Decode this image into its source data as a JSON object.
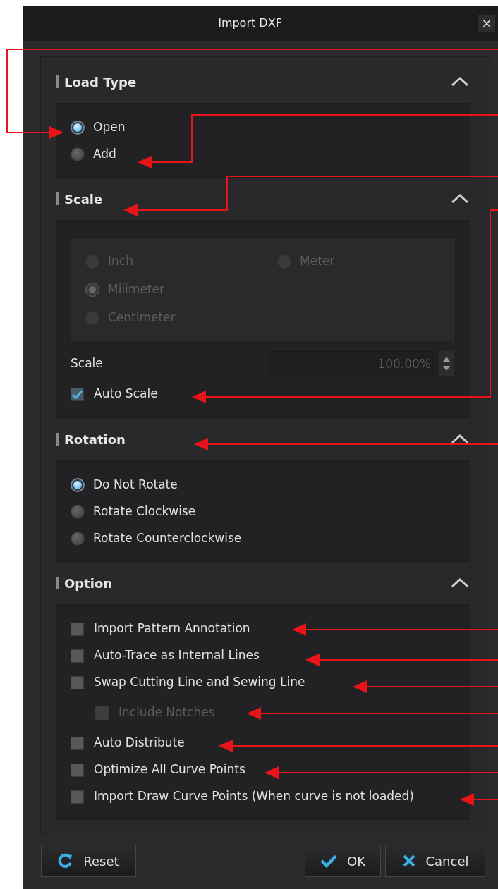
{
  "window": {
    "title": "Import DXF",
    "close": "×"
  },
  "sections": [
    {
      "title": "Load Type",
      "expanded": true,
      "kind": "radios",
      "items": [
        {
          "label": "Open",
          "selected": true,
          "disabled": false
        },
        {
          "label": "Add",
          "selected": false,
          "disabled": false
        }
      ]
    },
    {
      "title": "Scale",
      "expanded": true,
      "kind": "scale",
      "units": [
        {
          "label": "Inch",
          "selected": false,
          "disabled": true
        },
        {
          "label": "Milimeter",
          "selected": true,
          "disabled": true
        },
        {
          "label": "Centimeter",
          "selected": false,
          "disabled": true
        },
        {
          "label": "Meter",
          "selected": false,
          "disabled": true
        }
      ],
      "field": {
        "label": "Scale",
        "value": "100.00%",
        "disabled": true
      },
      "auto_scale": {
        "label": "Auto Scale",
        "checked": true,
        "disabled": false
      }
    },
    {
      "title": "Rotation",
      "expanded": true,
      "kind": "radios",
      "items": [
        {
          "label": "Do Not Rotate",
          "selected": true,
          "disabled": false
        },
        {
          "label": "Rotate Clockwise",
          "selected": false,
          "disabled": false
        },
        {
          "label": "Rotate Counterclockwise",
          "selected": false,
          "disabled": false
        }
      ]
    },
    {
      "title": "Option",
      "expanded": true,
      "kind": "checks",
      "items": [
        {
          "label": "Import Pattern Annotation",
          "checked": false,
          "disabled": false
        },
        {
          "label": "Auto-Trace as Internal Lines",
          "checked": false,
          "disabled": false
        },
        {
          "label": "Swap Cutting Line and Sewing Line",
          "checked": false,
          "disabled": false,
          "children": [
            {
              "label": "Include Notches",
              "checked": false,
              "disabled": true
            }
          ]
        },
        {
          "label": "Auto Distribute",
          "checked": false,
          "disabled": false
        },
        {
          "label": "Optimize All Curve Points",
          "checked": false,
          "disabled": false
        },
        {
          "label": "Import Draw Curve Points (When curve is not loaded)",
          "checked": false,
          "disabled": false
        }
      ]
    }
  ],
  "buttons": [
    {
      "label": "Reset",
      "kind": "reset"
    },
    {
      "label": "OK",
      "kind": "ok"
    },
    {
      "label": "Cancel",
      "kind": "cancel"
    }
  ]
}
